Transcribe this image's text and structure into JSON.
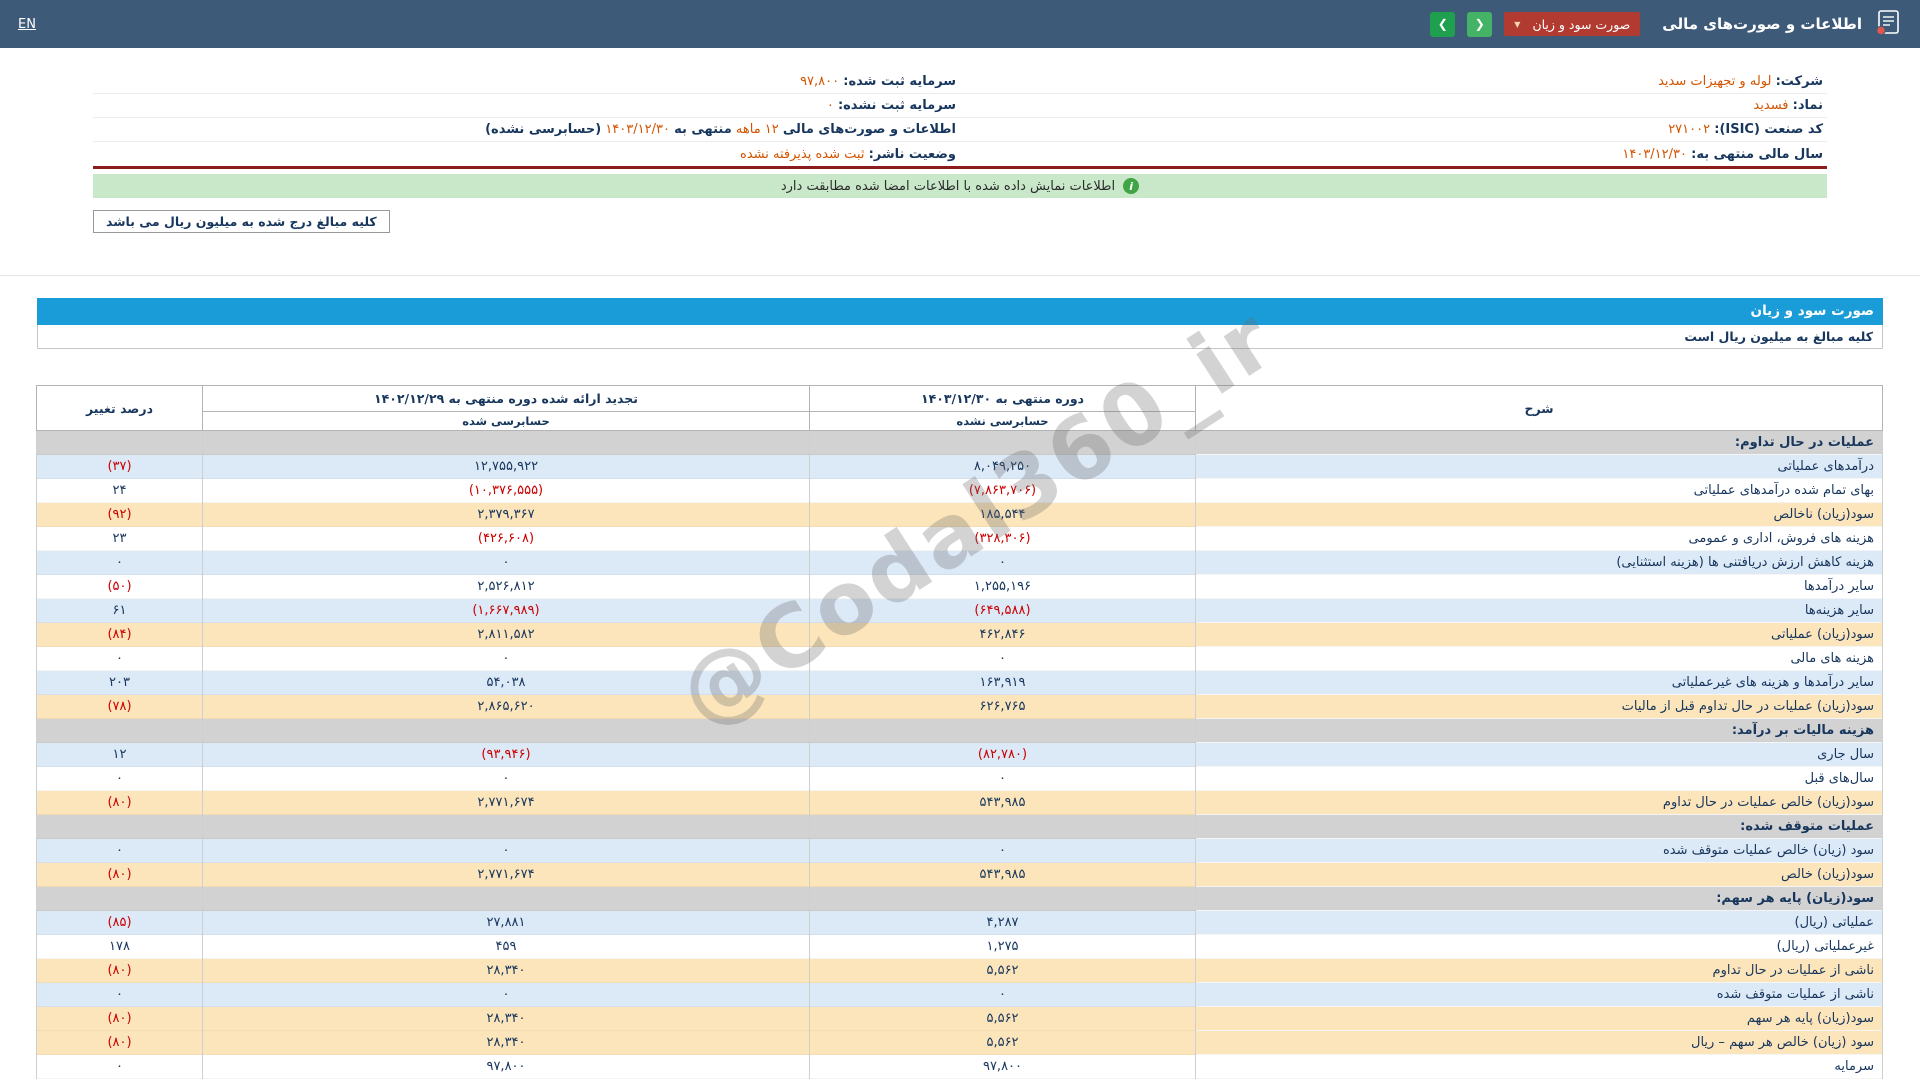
{
  "colors": {
    "topbar": "#3d5a78",
    "dropdown_red": "#b13a31",
    "nav_green": "#2fa84f",
    "statement_title_blue": "#199cd8",
    "navy_text": "#17365d",
    "negative_red": "#cc0000",
    "info_value_orange": "#d35400",
    "row_blue": "#dce9f7",
    "row_yellow": "#fce5ba",
    "row_section_gray": "#d2d2d2",
    "banner_green": "#c9e7c9",
    "red_divider": "#8a1c1c"
  },
  "icons": {
    "chevron_down": "▼",
    "chevron_left": "❮",
    "chevron_right": "❯",
    "info": "i"
  },
  "header": {
    "title": "اطلاعات و صورت‌های مالی",
    "statement_dropdown": "صورت سود و زیان",
    "language": "EN"
  },
  "company_info": {
    "right": [
      {
        "label": "شرکت:",
        "value": "لوله و تجهیزات سدید"
      },
      {
        "label": "نماد:",
        "value": "فسدید"
      },
      {
        "label": "کد صنعت (ISIC):",
        "value": "۲۷۱۰۰۲"
      },
      {
        "label": "سال مالی منتهی به:",
        "value": "۱۴۰۳/۱۲/۳۰"
      }
    ],
    "left": [
      {
        "label": "سرمایه ثبت شده:",
        "value": "۹۷,۸۰۰"
      },
      {
        "label": "سرمایه ثبت نشده:",
        "value": "۰"
      },
      {
        "label": "وضعیت ناشر:",
        "value": "ثبت شده پذیرفته نشده"
      }
    ],
    "period_line": {
      "p1": "اطلاعات و صورت‌های مالی",
      "p2": "۱۲ ماهه",
      "p3": "منتهی به",
      "p4": "۱۴۰۳/۱۲/۳۰",
      "p5": "(حسابرسی نشده)"
    }
  },
  "banners": {
    "signature_match": "اطلاعات نمایش داده شده با اطلاعات امضا شده مطابقت دارد",
    "amounts_note": "کلیه مبالغ درج شده به میلیون ریال می باشد"
  },
  "watermark": "@Codal360_ir",
  "statement": {
    "title": "صورت سود و زیان",
    "note": "کلیه مبالغ به میلیون ریال است",
    "columns": {
      "desc": "شرح",
      "period1": "دوره منتهی به ۱۴۰۳/۱۲/۳۰",
      "period1_sub": "حسابرسی نشده",
      "period2": "تجدید ارائه شده دوره منتهی به ۱۴۰۲/۱۲/۲۹",
      "period2_sub": "حسابرسی شده",
      "pct": "درصد تغییر"
    },
    "rows": [
      {
        "desc": "عملیات در حال تداوم:",
        "v1": "",
        "v2": "",
        "pct": "",
        "style": "section"
      },
      {
        "desc": "درآمدهای عملیاتی",
        "v1": "۸,۰۴۹,۲۵۰",
        "v2": "۱۲,۷۵۵,۹۲۲",
        "pct": "(۳۷)",
        "style": "blue"
      },
      {
        "desc": "بهای تمام شده درآمدهای عملیاتی",
        "v1": "(۷,۸۶۳,۷۰۶)",
        "v2": "(۱۰,۳۷۶,۵۵۵)",
        "pct": "۲۴",
        "style": "white"
      },
      {
        "desc": "سود(زیان) ناخالص",
        "v1": "۱۸۵,۵۴۴",
        "v2": "۲,۳۷۹,۳۶۷",
        "pct": "(۹۲)",
        "style": "yellow"
      },
      {
        "desc": "هزینه های فروش، اداری و عمومی",
        "v1": "(۳۲۸,۳۰۶)",
        "v2": "(۴۲۶,۶۰۸)",
        "pct": "۲۳",
        "style": "white"
      },
      {
        "desc": "هزینه کاهش ارزش دریافتنی ها (هزینه استثنایی)",
        "v1": "۰",
        "v2": "۰",
        "pct": "۰",
        "style": "blue"
      },
      {
        "desc": "سایر درآمدها",
        "v1": "۱,۲۵۵,۱۹۶",
        "v2": "۲,۵۲۶,۸۱۲",
        "pct": "(۵۰)",
        "style": "white"
      },
      {
        "desc": "سایر هزینه‌ها",
        "v1": "(۶۴۹,۵۸۸)",
        "v2": "(۱,۶۶۷,۹۸۹)",
        "pct": "۶۱",
        "style": "blue"
      },
      {
        "desc": "سود(زیان) عملیاتی",
        "v1": "۴۶۲,۸۴۶",
        "v2": "۲,۸۱۱,۵۸۲",
        "pct": "(۸۴)",
        "style": "yellow"
      },
      {
        "desc": "هزینه های مالی",
        "v1": "۰",
        "v2": "۰",
        "pct": "۰",
        "style": "white"
      },
      {
        "desc": "سایر درآمدها و هزینه های غیرعملیاتی",
        "v1": "۱۶۳,۹۱۹",
        "v2": "۵۴,۰۳۸",
        "pct": "۲۰۳",
        "style": "blue"
      },
      {
        "desc": "سود(زیان) عملیات در حال تداوم قبل از مالیات",
        "v1": "۶۲۶,۷۶۵",
        "v2": "۲,۸۶۵,۶۲۰",
        "pct": "(۷۸)",
        "style": "yellow"
      },
      {
        "desc": "هزینه مالیات بر درآمد:",
        "v1": "",
        "v2": "",
        "pct": "",
        "style": "section"
      },
      {
        "desc": "سال جاری",
        "v1": "(۸۲,۷۸۰)",
        "v2": "(۹۳,۹۴۶)",
        "pct": "۱۲",
        "style": "blue"
      },
      {
        "desc": "سال‌های قبل",
        "v1": "۰",
        "v2": "۰",
        "pct": "۰",
        "style": "white"
      },
      {
        "desc": "سود(زیان) خالص عملیات در حال تداوم",
        "v1": "۵۴۳,۹۸۵",
        "v2": "۲,۷۷۱,۶۷۴",
        "pct": "(۸۰)",
        "style": "yellow"
      },
      {
        "desc": "عملیات متوقف شده:",
        "v1": "",
        "v2": "",
        "pct": "",
        "style": "section"
      },
      {
        "desc": "سود (زیان) خالص عملیات متوقف شده",
        "v1": "۰",
        "v2": "۰",
        "pct": "۰",
        "style": "blue"
      },
      {
        "desc": "سود(زیان) خالص",
        "v1": "۵۴۳,۹۸۵",
        "v2": "۲,۷۷۱,۶۷۴",
        "pct": "(۸۰)",
        "style": "yellow"
      },
      {
        "desc": "سود(زیان) پایه هر سهم:",
        "v1": "",
        "v2": "",
        "pct": "",
        "style": "section"
      },
      {
        "desc": "عملیاتی (ریال)",
        "v1": "۴,۲۸۷",
        "v2": "۲۷,۸۸۱",
        "pct": "(۸۵)",
        "style": "blue"
      },
      {
        "desc": "غیرعملیاتی (ریال)",
        "v1": "۱,۲۷۵",
        "v2": "۴۵۹",
        "pct": "۱۷۸",
        "style": "white"
      },
      {
        "desc": "ناشی از عملیات در حال تداوم",
        "v1": "۵,۵۶۲",
        "v2": "۲۸,۳۴۰",
        "pct": "(۸۰)",
        "style": "yellow"
      },
      {
        "desc": "ناشی از عملیات متوقف شده",
        "v1": "۰",
        "v2": "۰",
        "pct": "۰",
        "style": "blue"
      },
      {
        "desc": "سود(زیان) پایه هر سهم",
        "v1": "۵,۵۶۲",
        "v2": "۲۸,۳۴۰",
        "pct": "(۸۰)",
        "style": "yellow"
      },
      {
        "desc": "سود (زیان) خالص هر سهم – ریال",
        "v1": "۵,۵۶۲",
        "v2": "۲۸,۳۴۰",
        "pct": "(۸۰)",
        "style": "yellow"
      },
      {
        "desc": "سرمایه",
        "v1": "۹۷,۸۰۰",
        "v2": "۹۷,۸۰۰",
        "pct": "۰",
        "style": "white"
      }
    ]
  }
}
